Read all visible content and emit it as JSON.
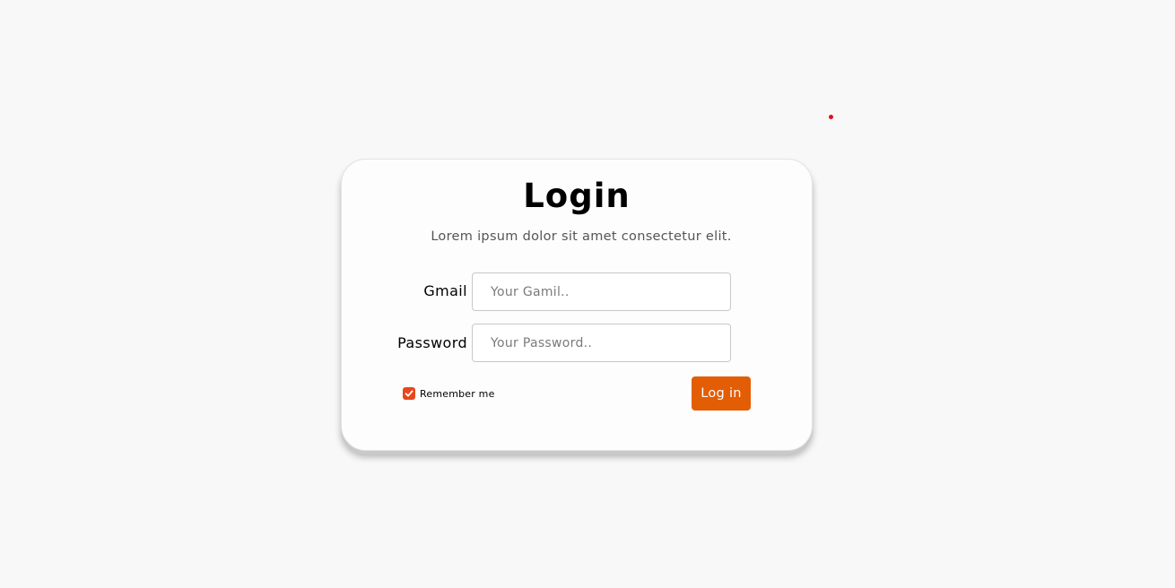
{
  "login_form": {
    "title": "Login",
    "subtitle": "Lorem ipsum dolor sit amet consectetur elit.",
    "gmail": {
      "label": "Gmail",
      "value": "",
      "placeholder": "Your Gamil.."
    },
    "password": {
      "label": "Password",
      "value": "",
      "placeholder": "Your Password.."
    },
    "remember": {
      "label": "Remember me",
      "checked": true,
      "icon": "check-icon"
    },
    "submit_label": "Log in"
  },
  "colors": {
    "accent": "#e35d05",
    "checkbox": "#e8461c",
    "dot": "#e0101c",
    "background": "#f8f8f8",
    "card": "#fdfdfd"
  }
}
